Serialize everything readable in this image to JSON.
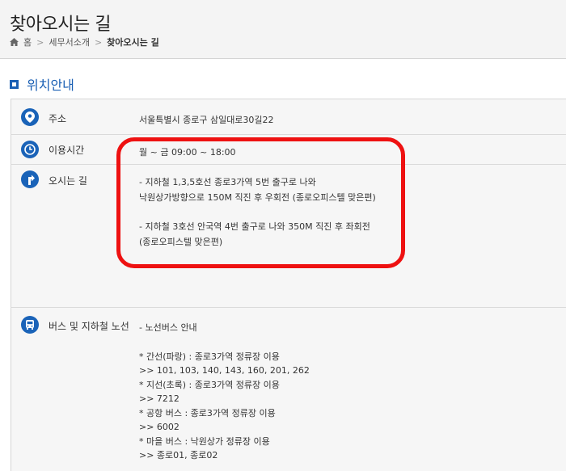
{
  "page": {
    "title": "찾아오시는 길"
  },
  "breadcrumb": {
    "home": "홈",
    "parent": "세무서소개",
    "current": "찾아오시는 길"
  },
  "section": {
    "title": "위치안내"
  },
  "rows": {
    "address": {
      "label": "주소",
      "value": "서울특별시 종로구 삼일대로30길22"
    },
    "hours": {
      "label": "이용시간",
      "value": "월 ~ 금 09:00 ~ 18:00"
    },
    "directions": {
      "label": "오시는 길",
      "line1": "- 지하철 1,3,5호선 종로3가역 5번 출구로 나와",
      "line2": "낙원상가방향으로 150M 직진 후 우회전 (종로오피스텔 맞은편)",
      "line3": "- 지하철 3호선 안국역 4번 출구로 나와 350M 직진 후 좌회전",
      "line4": "(종로오피스텔 맞은편)"
    },
    "bus": {
      "label": "버스 및 지하철 노선",
      "heading": "- 노선버스 안내",
      "lines": [
        "* 간선(파랑) : 종로3가역 정류장 이용",
        ">> 101, 103, 140, 143, 160, 201, 262",
        "* 지선(초록) : 종로3가역 정류장 이용",
        ">> 7212",
        "* 공항 버스 : 종로3가역 정류장 이용",
        ">> 6002",
        "* 마을 버스 : 낙원상가 정류장 이용",
        ">> 종로01, 종로02"
      ]
    }
  },
  "icons": {
    "home": "home-icon",
    "address": "location-pin-icon",
    "hours": "clock-icon",
    "directions": "direction-sign-icon",
    "bus": "bus-icon"
  },
  "colors": {
    "accent": "#1a63b8",
    "highlight": "#ee1111"
  }
}
